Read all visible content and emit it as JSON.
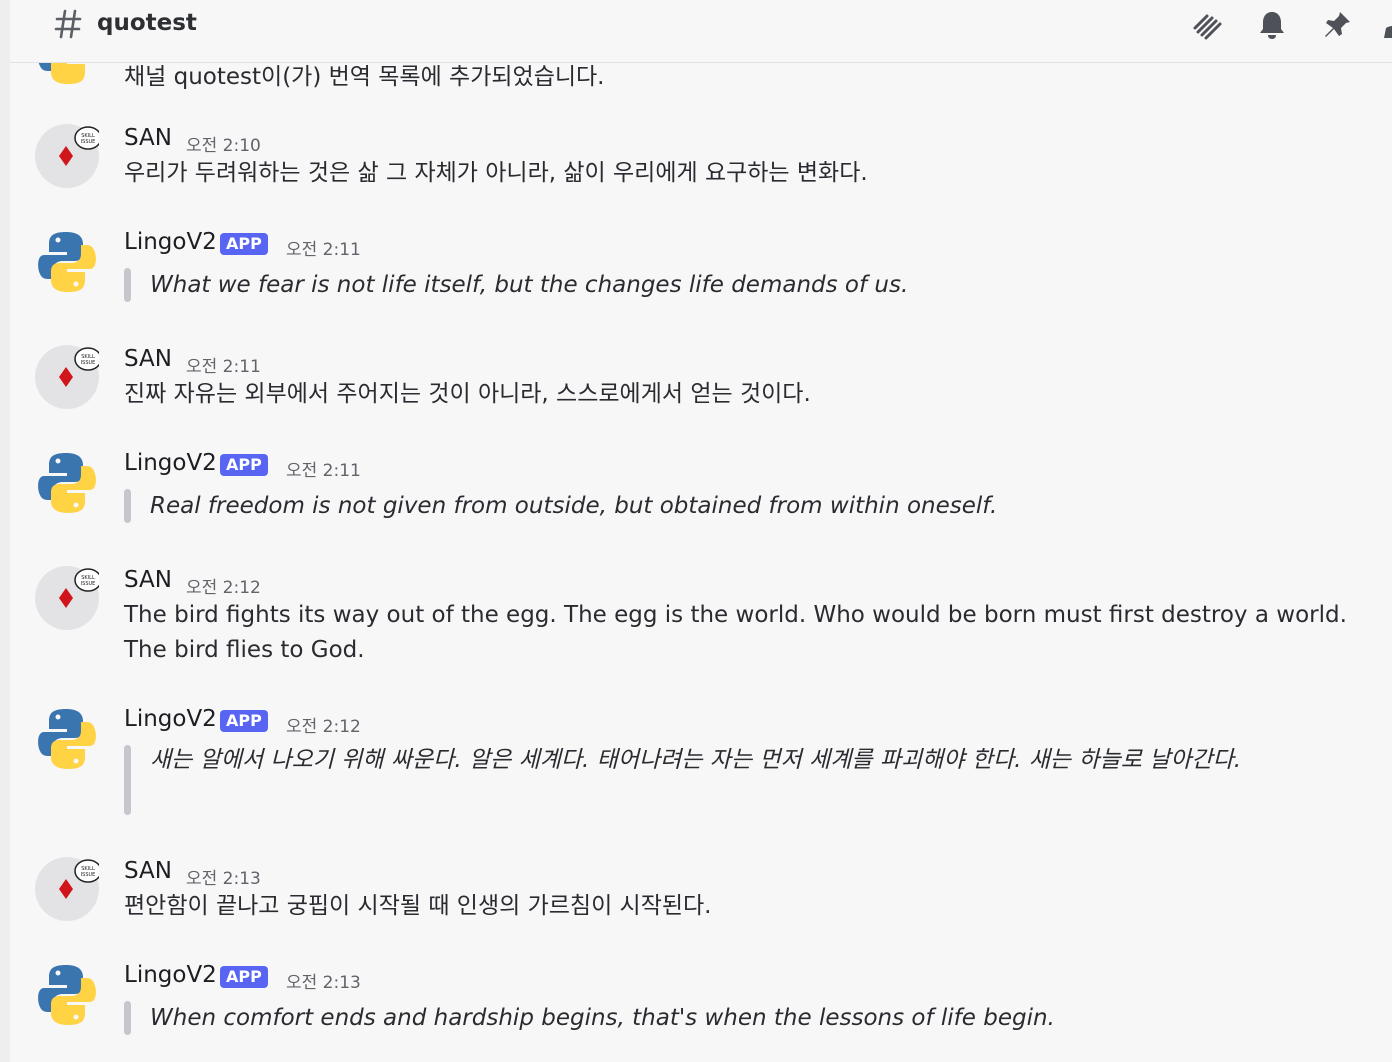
{
  "channel": {
    "title": "quotest"
  },
  "header_icons": [
    "threads-icon",
    "bell-icon",
    "pin-icon"
  ],
  "system_message": {
    "text": "채널 quotest이(가) 번역 목록에 추가되었습니다."
  },
  "messages": [
    {
      "author": "SAN",
      "time": "오전 2:10",
      "text": "우리가 두려워하는 것은 삶 그 자체가 아니라, 삶이 우리에게 요구하는 변화다."
    },
    {
      "author": "LingoV2",
      "badge": "APP",
      "time": "오전 2:11",
      "quote": "What we fear is not life itself, but the changes life demands of us."
    },
    {
      "author": "SAN",
      "time": "오전 2:11",
      "text": "진짜 자유는 외부에서 주어지는 것이 아니라, 스스로에게서 얻는 것이다."
    },
    {
      "author": "LingoV2",
      "badge": "APP",
      "time": "오전 2:11",
      "quote": "Real freedom is not given from outside, but obtained from within oneself."
    },
    {
      "author": "SAN",
      "time": "오전 2:12",
      "text": "The bird fights its way out of the egg. The egg is the world. Who would be born must first destroy a world. The bird flies to God."
    },
    {
      "author": "LingoV2",
      "badge": "APP",
      "time": "오전 2:12",
      "quote": "새는 알에서 나오기 위해 싸운다. 알은 세계다. 태어나려는 자는 먼저 세계를 파괴해야 한다. 새는 하늘로 날아간다."
    },
    {
      "author": "SAN",
      "time": "오전 2:13",
      "text": "편안함이 끝나고 궁핍이 시작될 때 인생의 가르침이 시작된다."
    },
    {
      "author": "LingoV2",
      "badge": "APP",
      "time": "오전 2:13",
      "quote": "When comfort ends and hardship begins, that's when the lessons of life begin."
    }
  ],
  "colors": {
    "badge": "#5865f2",
    "quote_bar": "#c6c7cc",
    "diamond": "#d0161b",
    "python_blue": "#3a75b0",
    "python_yellow": "#ffd343"
  }
}
